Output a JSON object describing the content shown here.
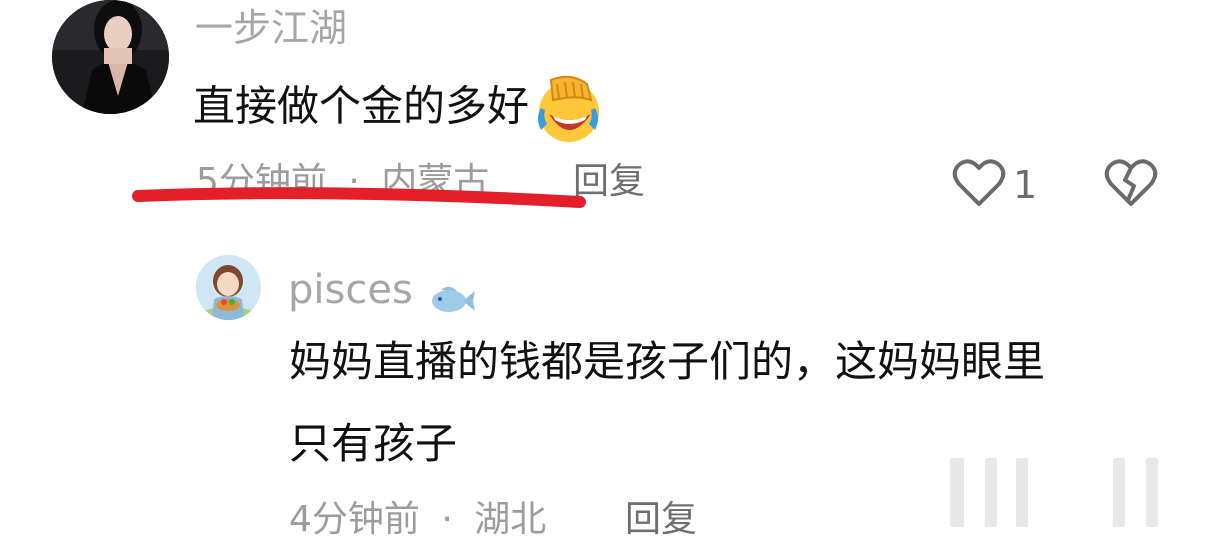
{
  "comment": {
    "username": "一步江湖",
    "text": "直接做个金的多好",
    "emoji_icon": "facepalm-laugh-emoji",
    "time": "5分钟前",
    "separator": "·",
    "location": "内蒙古",
    "reply_label": "回复",
    "like_count": "1",
    "annotation_color": "#e3202a"
  },
  "reply": {
    "username": "pisces",
    "badge_icon": "fish-icon",
    "text_line1": "妈妈直播的钱都是孩子们的，这妈妈眼里",
    "text_line2": "只有孩子",
    "time": "4分钟前",
    "separator": "·",
    "location": "湖北",
    "reply_label": "回复"
  }
}
